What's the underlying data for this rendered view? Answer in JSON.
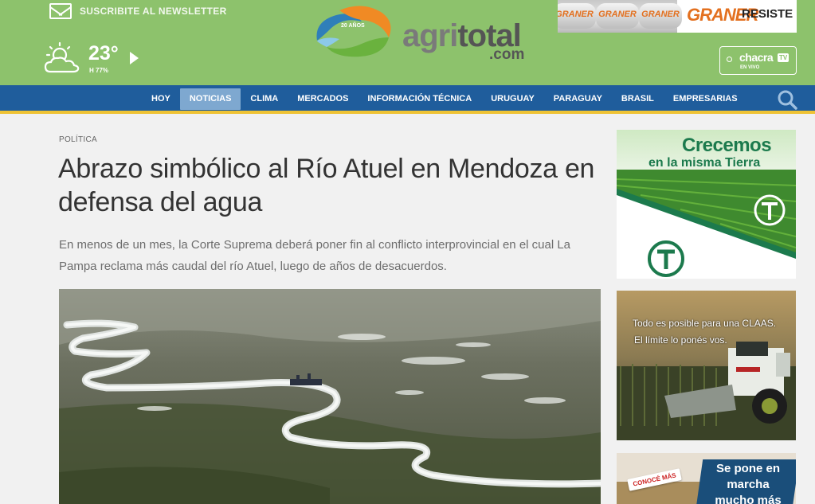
{
  "header": {
    "newsletter_label": "SUSCRIBITE AL NEWSLETTER",
    "weather": {
      "temperature": "23°",
      "humidity": "H 77%"
    },
    "logo": {
      "years": "20 AÑOS",
      "name_agri": "agri",
      "name_total": "total",
      "domain": ".com"
    },
    "top_ad": {
      "bag_label": "GRANER",
      "brand": "GRANER",
      "slogan": "RESISTE"
    },
    "chacra_tv": {
      "name": "chacra",
      "tv": "TV",
      "status": "EN VIVO"
    }
  },
  "nav": {
    "items": [
      {
        "label": "HOY"
      },
      {
        "label": "NOTICIAS"
      },
      {
        "label": "CLIMA"
      },
      {
        "label": "MERCADOS"
      },
      {
        "label": "INFORMACIÓN TÉCNICA"
      },
      {
        "label": "URUGUAY"
      },
      {
        "label": "PARAGUAY"
      },
      {
        "label": "BRASIL"
      },
      {
        "label": "EMPRESARIAS"
      }
    ],
    "active_index": 1
  },
  "article": {
    "category": "POLÍTICA",
    "title": "Abrazo simbólico al Río Atuel en Mendoza en defensa del agua",
    "lead": "En menos de un mes, la Corte Suprema deberá poner fin al conflicto interprovincial en el cual La Pampa reclama más caudal del río Atuel, luego de años de desacuerdos."
  },
  "sidebar_ads": {
    "ad1": {
      "line1": "Crecemos",
      "line2": "en la misma Tierra"
    },
    "ad2": {
      "line1": "Todo es posible para una CLAAS.",
      "line2": "El límite lo ponés vos."
    },
    "ad3": {
      "badge": "CONOCÉ MÁS",
      "text": "Se pone en marcha mucho más"
    }
  },
  "colors": {
    "header_green": "#8dc26c",
    "nav_blue": "#1f5d9c",
    "nav_active": "#7ea8d0",
    "accent_yellow": "#efc335",
    "graner_orange": "#e3701f",
    "ad_green": "#1c7a4d"
  }
}
